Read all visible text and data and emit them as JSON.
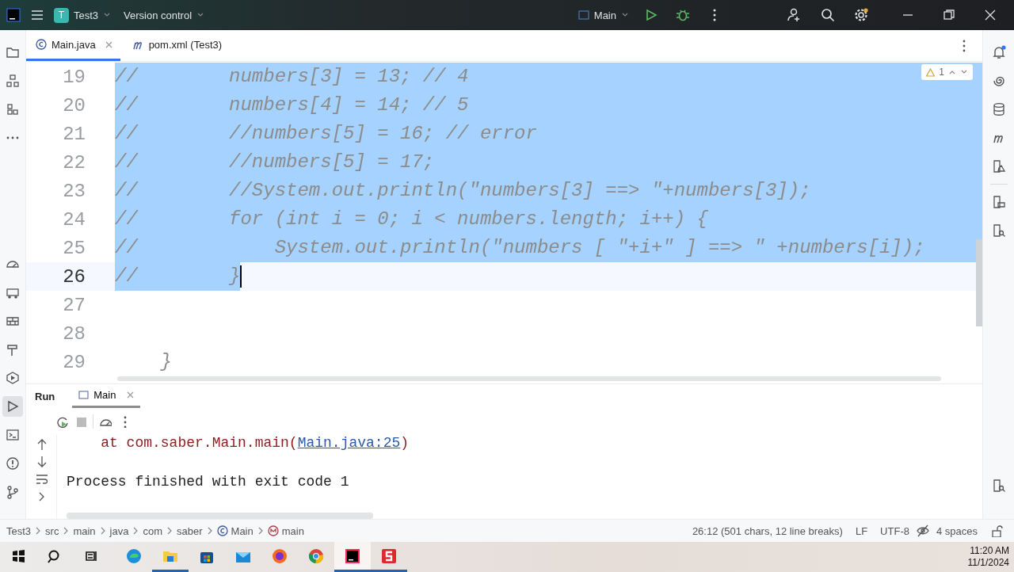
{
  "title_bar": {
    "project_badge": "T",
    "project": "Test3",
    "vcs": "Version control",
    "run_config": "Main"
  },
  "editor_tabs": [
    {
      "label": "Main.java",
      "kind": "java",
      "selected": true
    },
    {
      "label": "pom.xml (Test3)",
      "kind": "maven",
      "selected": false
    }
  ],
  "editor": {
    "inspection_count": "1",
    "lines": [
      {
        "number": "19",
        "text": "//        numbers[3] = 13; // 4",
        "selected": true,
        "current": false
      },
      {
        "number": "20",
        "text": "//        numbers[4] = 14; // 5",
        "selected": true,
        "current": false
      },
      {
        "number": "21",
        "text": "//        //numbers[5] = 16; // error",
        "selected": true,
        "current": false
      },
      {
        "number": "22",
        "text": "//        //numbers[5] = 17;",
        "selected": true,
        "current": false
      },
      {
        "number": "23",
        "text": "//        //System.out.println(\"numbers[3] ==> \"+numbers[3]);",
        "selected": true,
        "current": false
      },
      {
        "number": "24",
        "text": "//        for (int i = 0; i < numbers.length; i++) {",
        "selected": true,
        "current": false
      },
      {
        "number": "25",
        "text": "//            System.out.println(\"numbers [ \"+i+\" ] ==> \" +numbers[i]);",
        "selected": true,
        "current": false
      },
      {
        "number": "26",
        "text": "//        }",
        "selected": true,
        "current": true
      },
      {
        "number": "27",
        "selected": false,
        "current": false
      },
      {
        "number": "28",
        "selected": false,
        "current": false
      },
      {
        "number": "29",
        "text": "    }",
        "selected": false,
        "current": false
      }
    ]
  },
  "run_panel": {
    "title": "Run",
    "tabs": [
      {
        "label": "Main",
        "selected": true
      }
    ],
    "output": [
      {
        "kind": "trace",
        "text": "    at com.saber.Main.main(",
        "link": "Main.java:25",
        "suffix": ")"
      },
      {
        "kind": "plain",
        "text": "Process finished with exit code 1"
      }
    ]
  },
  "breadcrumbs": [
    {
      "label": "Test3",
      "kind": "module"
    },
    {
      "label": "src",
      "kind": "folder"
    },
    {
      "label": "main",
      "kind": "folder"
    },
    {
      "label": "java",
      "kind": "folder"
    },
    {
      "label": "com",
      "kind": "folder"
    },
    {
      "label": "saber",
      "kind": "folder"
    },
    {
      "label": "Main",
      "kind": "class"
    },
    {
      "label": "main",
      "kind": "method"
    }
  ],
  "status": [
    "26:12 (501 chars, 12 line breaks)",
    "LF",
    "UTF-8",
    "4 spaces"
  ],
  "taskbar": {
    "apps": [
      {
        "kind": "edge",
        "running": false
      },
      {
        "kind": "explorer",
        "running": true
      },
      {
        "kind": "store",
        "running": false
      },
      {
        "kind": "mail",
        "running": false
      },
      {
        "kind": "firefox",
        "running": false
      },
      {
        "kind": "chrome",
        "running": false
      },
      {
        "kind": "ide",
        "running": true
      },
      {
        "kind": "s",
        "running": true
      }
    ],
    "time": "11:20 AM",
    "date": "11/1/2024"
  }
}
